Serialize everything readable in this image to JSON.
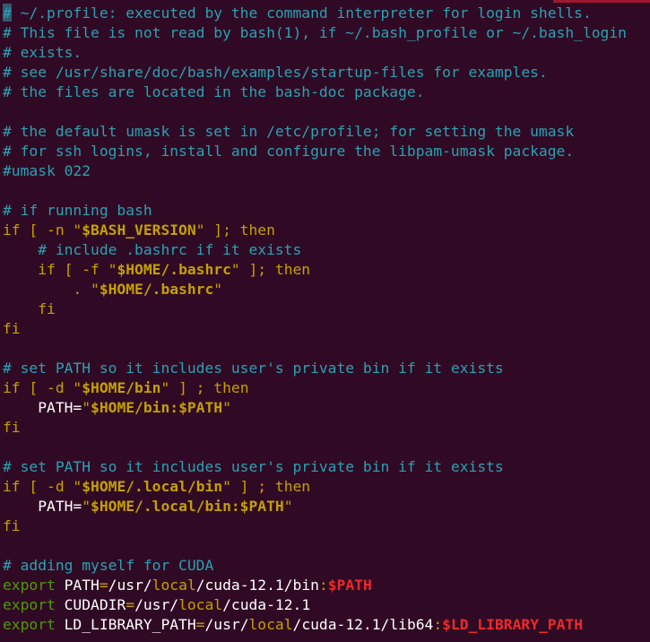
{
  "terminal": {
    "lines": [
      [
        "# ~/.profile: executed by the command interpreter for login shells."
      ],
      [
        "# This file is not read by bash(1), if ~/.bash_profile or ~/.bash_login"
      ],
      [
        "# exists."
      ],
      [
        "# see /usr/share/doc/bash/examples/startup-files for examples."
      ],
      [
        "# the files are located in the bash-doc package."
      ],
      [
        ""
      ],
      [
        "# the default umask is set in /etc/profile; for setting the umask"
      ],
      [
        "# for ssh logins, install and configure the libpam-umask package."
      ],
      [
        "#umask 022"
      ],
      [
        ""
      ],
      [
        "# if running bash"
      ],
      [
        "if [ ",
        "-n",
        " \"",
        "$BASH_VERSION",
        "\" ]; then"
      ],
      [
        "    ",
        "# include .bashrc if it exists"
      ],
      [
        "    ",
        "if [ ",
        "-f",
        " \"",
        "$HOME/.bashrc",
        "\" ]; then"
      ],
      [
        "        . \"",
        "$HOME/.bashrc",
        "\""
      ],
      [
        "    ",
        "fi"
      ],
      [
        "fi"
      ],
      [
        ""
      ],
      [
        "# set PATH so it includes user's private bin if it exists"
      ],
      [
        "if [ ",
        "-d",
        " \"",
        "$HOME/bin",
        "\" ] ; then"
      ],
      [
        "    PATH=",
        "\"",
        "$HOME/bin:$PATH",
        "\""
      ],
      [
        "fi"
      ],
      [
        ""
      ],
      [
        "# set PATH so it includes user's private bin if it exists"
      ],
      [
        "if [ ",
        "-d",
        " \"",
        "$HOME/.local/bin",
        "\" ] ; then"
      ],
      [
        "    PATH=",
        "\"",
        "$HOME/.local/bin:$PATH",
        "\""
      ],
      [
        "fi"
      ],
      [
        ""
      ],
      [
        "# adding myself for CUDA"
      ],
      [
        "export",
        " PATH",
        "=",
        "/usr/",
        "local",
        "/cuda-12.1/bin",
        ":",
        "$PATH"
      ],
      [
        "export",
        " CUDADIR",
        "=",
        "/usr/",
        "local",
        "/cuda-12.1"
      ],
      [
        "export",
        " LD_LIBRARY_PATH",
        "=",
        "/usr/",
        "local",
        "/cuda-12.1/lib64",
        ":",
        "$LD_LIBRARY_PATH"
      ]
    ]
  },
  "colors": {
    "background": "#300a24",
    "comment": "#2aa1b3",
    "keyword": "#c4a000",
    "variable_bold": "#fce94f",
    "error_red": "#ef2929",
    "export_green": "#4e9a06",
    "text": "#ffffff"
  }
}
